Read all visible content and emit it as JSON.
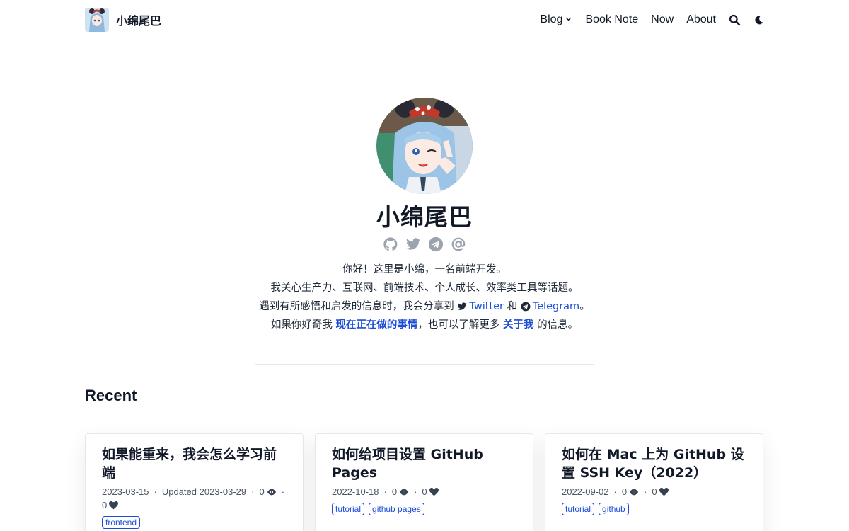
{
  "header": {
    "brand_name": "小绵尾巴",
    "nav": {
      "blog": "Blog",
      "book_note": "Book Note",
      "now": "Now",
      "about": "About"
    },
    "icons": [
      "chevron-down-icon",
      "search-icon",
      "moon-icon"
    ]
  },
  "profile": {
    "name": "小绵尾巴",
    "social_icons": [
      "github-icon",
      "twitter-icon",
      "telegram-icon",
      "email-at-icon"
    ],
    "intro": {
      "line1": "你好！这里是小绵，一名前端开发。",
      "line2": "我关心生产力、互联网、前端技术、个人成长、效率类工具等话题。",
      "line3_pre": "遇到有所感悟和启发的信息时，我会分享到",
      "twitter_link": "Twitter",
      "line3_mid": "和",
      "telegram_link": "Telegram",
      "line3_post": "。",
      "line4_pre": "如果你好奇我",
      "now_link": "现在正在做的事情",
      "line4_mid": "，也可以了解更多",
      "about_link": "关于我",
      "line4_post": "的信息。"
    }
  },
  "recent": {
    "heading": "Recent",
    "posts": [
      {
        "title": "如果能重来，我会怎么学习前端",
        "date": "2023-03-15",
        "updated": "Updated 2023-03-29",
        "views": "0",
        "likes": "0",
        "tags": [
          "frontend"
        ]
      },
      {
        "title": "如何给项目设置 GitHub Pages",
        "date": "2022-10-18",
        "views": "0",
        "likes": "0",
        "tags": [
          "tutorial",
          "github pages"
        ]
      },
      {
        "title": "如何在 Mac 上为 GitHub 设置 SSH Key（2022）",
        "date": "2022-09-02",
        "views": "0",
        "likes": "0",
        "tags": [
          "tutorial",
          "github"
        ]
      }
    ]
  },
  "colors": {
    "link": "#1d4ed8",
    "text": "#111827",
    "muted": "#4b5563"
  }
}
